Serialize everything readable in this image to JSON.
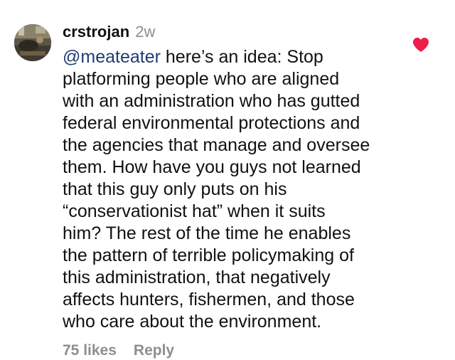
{
  "comment": {
    "username": "crstrojan",
    "time_ago": "2w",
    "mention": "@meateater",
    "first_line_rest": " here’s an idea:  Stop",
    "lines": [
      "platforming people who are aligned",
      "with an administration who has gutted",
      "federal environmental protections and",
      "the agencies that manage and oversee",
      "them.  How have you guys not learned",
      "that this guy only puts on his",
      "“conservationist hat” when it suits",
      "him?  The rest of the time he enables",
      "the pattern of terrible policymaking of",
      "this administration, that negatively",
      "affects hunters, fishermen, and those",
      "who care about the environment."
    ],
    "likes_label": "75 likes",
    "reply_label": "Reply",
    "liked": true
  },
  "icons": {
    "heart": "heart-icon",
    "avatar": "avatar"
  },
  "colors": {
    "heart": "#ed1d49",
    "mention": "#1f3d73",
    "muted": "#8e8e8e"
  }
}
